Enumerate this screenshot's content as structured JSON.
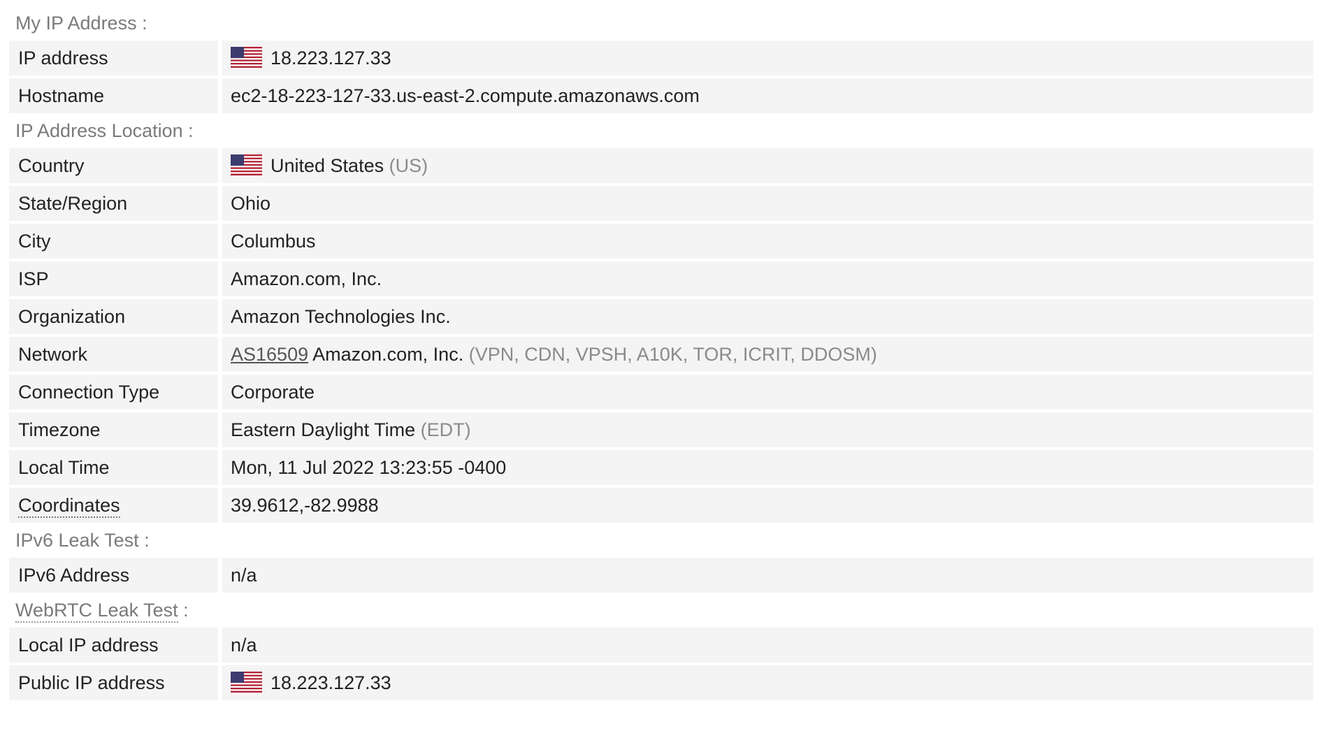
{
  "sections": {
    "my_ip": {
      "title": "My IP Address :",
      "rows": {
        "ip_address": {
          "label": "IP address",
          "value": "18.223.127.33",
          "flag": "us-flag-icon"
        },
        "hostname": {
          "label": "Hostname",
          "value": "ec2-18-223-127-33.us-east-2.compute.amazonaws.com"
        }
      }
    },
    "location": {
      "title": "IP Address Location :",
      "rows": {
        "country": {
          "label": "Country",
          "value": "United States",
          "code": "(US)",
          "flag": "us-flag-icon"
        },
        "state": {
          "label": "State/Region",
          "value": "Ohio"
        },
        "city": {
          "label": "City",
          "value": "Columbus"
        },
        "isp": {
          "label": "ISP",
          "value": "Amazon.com, Inc."
        },
        "organization": {
          "label": "Organization",
          "value": "Amazon Technologies Inc."
        },
        "network": {
          "label": "Network",
          "asn": "AS16509",
          "value": "Amazon.com, Inc.",
          "tags": "(VPN, CDN, VPSH, A10K, TOR, ICRIT, DDOSM)"
        },
        "connection_type": {
          "label": "Connection Type",
          "value": "Corporate"
        },
        "timezone": {
          "label": "Timezone",
          "value": "Eastern Daylight Time",
          "abbr": "(EDT)"
        },
        "local_time": {
          "label": "Local Time",
          "value": "Mon, 11 Jul 2022 13:23:55 -0400"
        },
        "coordinates": {
          "label": "Coordinates",
          "value": "39.9612,-82.9988"
        }
      }
    },
    "ipv6": {
      "title": "IPv6 Leak Test :",
      "rows": {
        "ipv6_address": {
          "label": "IPv6 Address",
          "value": "n/a"
        }
      }
    },
    "webrtc": {
      "title_link": "WebRTC Leak Test",
      "title_suffix": " :",
      "rows": {
        "local_ip": {
          "label": "Local IP address",
          "value": "n/a"
        },
        "public_ip": {
          "label": "Public IP address",
          "value": "18.223.127.33",
          "flag": "us-flag-icon"
        }
      }
    }
  },
  "colors": {
    "row_bg": "#f4f4f4",
    "section_title": "#7a7a7a",
    "muted_text": "#8a8a8a",
    "text": "#222222"
  }
}
